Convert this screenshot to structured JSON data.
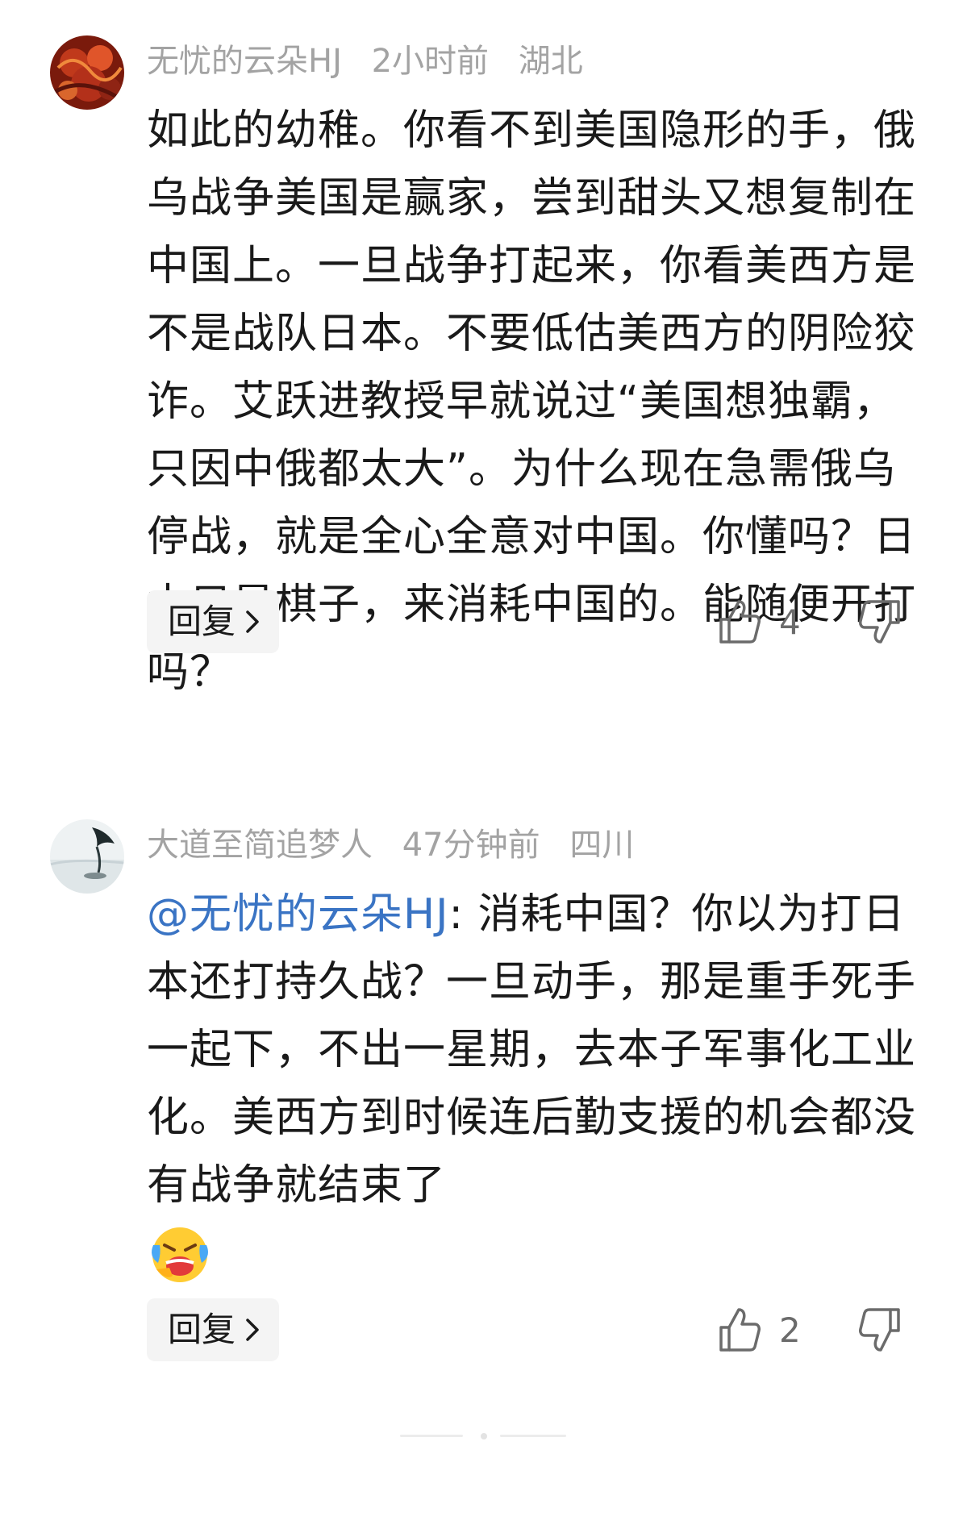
{
  "comments": [
    {
      "username": "无忧的云朵HJ",
      "time": "2小时前",
      "location": "湖北",
      "text": "如此的幼稚。你看不到美国隐形的手，俄乌战争美国是赢家，尝到甜头又想复制在中国上。一旦战争打起来，你看美西方是不是战队日本。不要低估美西方的阴险狡诈。艾跃进教授早就说过“美国想独霸，只因中俄都太大”。为什么现在急需俄乌停战，就是全心全意对中国。你懂吗？日本只是棋子，来消耗中国的。能随便开打吗？",
      "reply_label": "回复",
      "likes": "4"
    },
    {
      "username": "大道至简追梦人",
      "time": "47分钟前",
      "location": "四川",
      "mention": "@无忧的云朵HJ",
      "text": ": 消耗中国？你以为打日本还打持久战？一旦动手，那是重手死手一起下，不出一星期，去本子军事化工业化。美西方到时候连后勤支援的机会都没有战争就结束了",
      "emoji": "laughing-crying-emoji",
      "reply_label": "回复",
      "likes": "2"
    }
  ],
  "colors": {
    "meta_gray": "#a3a3a3",
    "mention_blue": "#3a74c4",
    "reply_bg": "#f4f4f4"
  }
}
